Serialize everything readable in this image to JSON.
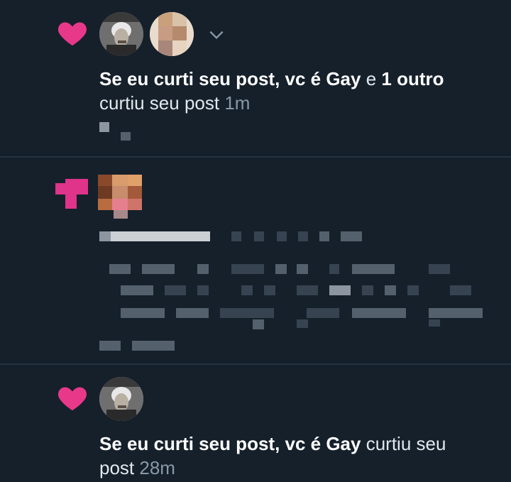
{
  "notifications": [
    {
      "type": "like",
      "user_name": "Se eu curti seu post, vc é Gay",
      "connector": "e",
      "others": "1 outro",
      "action": "curtiu seu post",
      "time": "1m",
      "icon": "heart-icon",
      "heart_color": "#e0245e"
    },
    {
      "type": "like",
      "user_name": "",
      "action": "",
      "time": "",
      "icon": "heart-icon",
      "heart_color": "#e83e8c"
    },
    {
      "type": "like",
      "user_name": "Se eu curti seu post, vc é Gay",
      "action_line1": "curtiu seu",
      "action_line2": "post",
      "time": "28m",
      "icon": "heart-icon",
      "heart_color": "#e0245e"
    }
  ],
  "colors": {
    "background": "#15202b",
    "divider": "#243340",
    "secondary_text": "#8899a6",
    "heart": "#e0245e"
  }
}
